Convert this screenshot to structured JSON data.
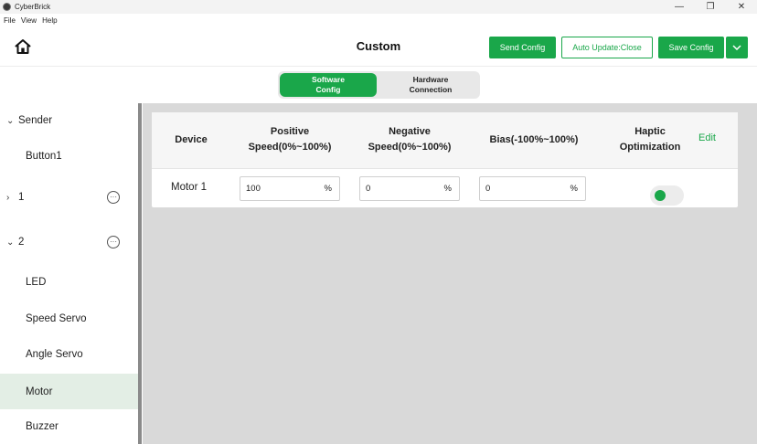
{
  "window": {
    "title": "CyberBrick",
    "controls": {
      "minimize": "—",
      "maximize": "❐",
      "close": "✕"
    }
  },
  "menu": [
    "File",
    "View",
    "Help"
  ],
  "header": {
    "title": "Custom",
    "send_config": "Send Config",
    "auto_update": "Auto Update:Close",
    "save_config": "Save Config"
  },
  "tabs": {
    "software": [
      "Software",
      "Config"
    ],
    "hardware": [
      "Hardware",
      "Connection"
    ]
  },
  "sidebar": {
    "items": [
      {
        "label": "Sender",
        "chevron": "⌄"
      },
      {
        "label": "Button1"
      },
      {
        "label": "1",
        "chevron": "›"
      },
      {
        "label": "2",
        "chevron": "⌄"
      },
      {
        "label": "LED"
      },
      {
        "label": "Speed Servo"
      },
      {
        "label": "Angle Servo"
      },
      {
        "label": "Motor",
        "selected": true
      },
      {
        "label": "Buzzer"
      }
    ]
  },
  "table": {
    "headers": {
      "device": "Device",
      "positive": [
        "Positive",
        "Speed(0%~100%)"
      ],
      "negative": [
        "Negative",
        "Speed(0%~100%)"
      ],
      "bias": "Bias(-100%~100%)",
      "haptic": [
        "Haptic",
        "Optimization"
      ],
      "edit": "Edit"
    },
    "rows": [
      {
        "device": "Motor 1",
        "positive": "100",
        "negative": "0",
        "bias": "0",
        "unit": "%",
        "haptic_on": true
      }
    ]
  },
  "colors": {
    "accent": "#1aa74a",
    "panel_bg": "#d9d9d9",
    "selected_bg": "#e3eee5"
  }
}
